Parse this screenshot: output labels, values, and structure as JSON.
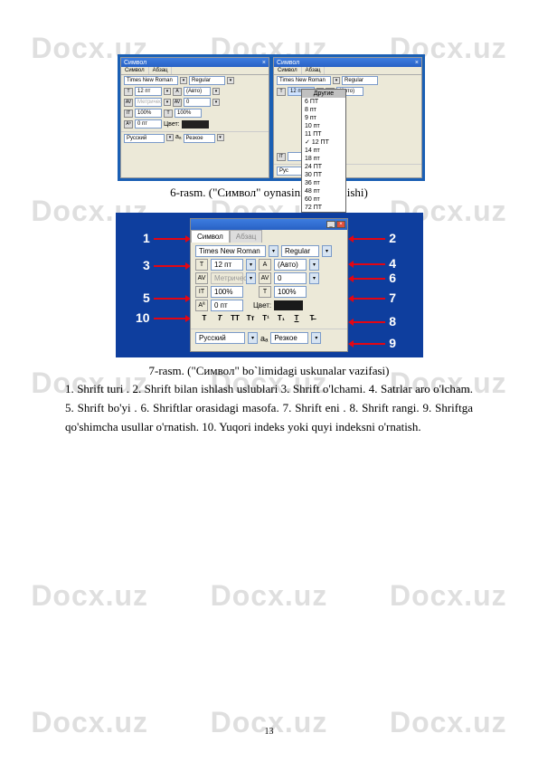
{
  "watermark": "Docx.uz",
  "fig1": {
    "title": "Символ",
    "tabs": [
      "Символ",
      "Абзац"
    ],
    "font": "Times New Roman",
    "style": "Regular",
    "size": "12 пт",
    "auto": "(Авто)",
    "metric": "Метричес",
    "zero": "0",
    "pct": "100%",
    "zeroPt": "0 пт",
    "colorLabel": "Цвет:",
    "lang": "Русский",
    "sharpness": "Резкое",
    "aa": "aₐ",
    "dropdownHeader": "Другие",
    "sizes": [
      "6 ПТ",
      "8 пт",
      "9 пт",
      "10 пт",
      "11 ПТ",
      "12 ПТ",
      "14 пт",
      "18 пт",
      "24 ПТ",
      "30 ПТ",
      "36 пт",
      "48 пт",
      "60 пт",
      "72 ПТ"
    ],
    "check": "✓"
  },
  "caption1": "6-rasm. (\"Символ\" oynasining ko`rinishi)",
  "fig2": {
    "tab1": "Символ",
    "tab2": "Абзац",
    "font": "Times New Roman",
    "style": "Regular",
    "size": "12 пт",
    "auto": "(Авто)",
    "metric": "Метричес",
    "zero": "0",
    "pct": "100%",
    "zeroPt": "0 пт",
    "colorLabel": "Цвет:",
    "lang": "Русский",
    "sharpness": "Резкое",
    "aa": "aₐ",
    "iconT": "T",
    "iconIT": "IT",
    "iconAV": "AV",
    "iconAA": "Aª",
    "btnStrike": "T̶",
    "nums": [
      "1",
      "2",
      "3",
      "4",
      "5",
      "6",
      "7",
      "8",
      "9",
      "10"
    ]
  },
  "caption2": "7-rasm. (\"Символ\" bo`limidagi uskunalar vazifasi)",
  "bodyText": "1.   Shrift turi .  2.  Shrift bilan ishlash uslublari   3.   Shrift o'lchami.    4.   Satrlar aro o'lcham.   5.   Shrift bo'yi .  6.   Shriftlar  orasidagi masofa.   7.   Shrift  eni .  8.   Shrift rangi.  9.    Shriftga  qo'shimcha  usullar  o'rnatish.    10.  Yuqori  indeks  yoki  quyi indeksni   o'rnatish.",
  "pageNum": "13"
}
